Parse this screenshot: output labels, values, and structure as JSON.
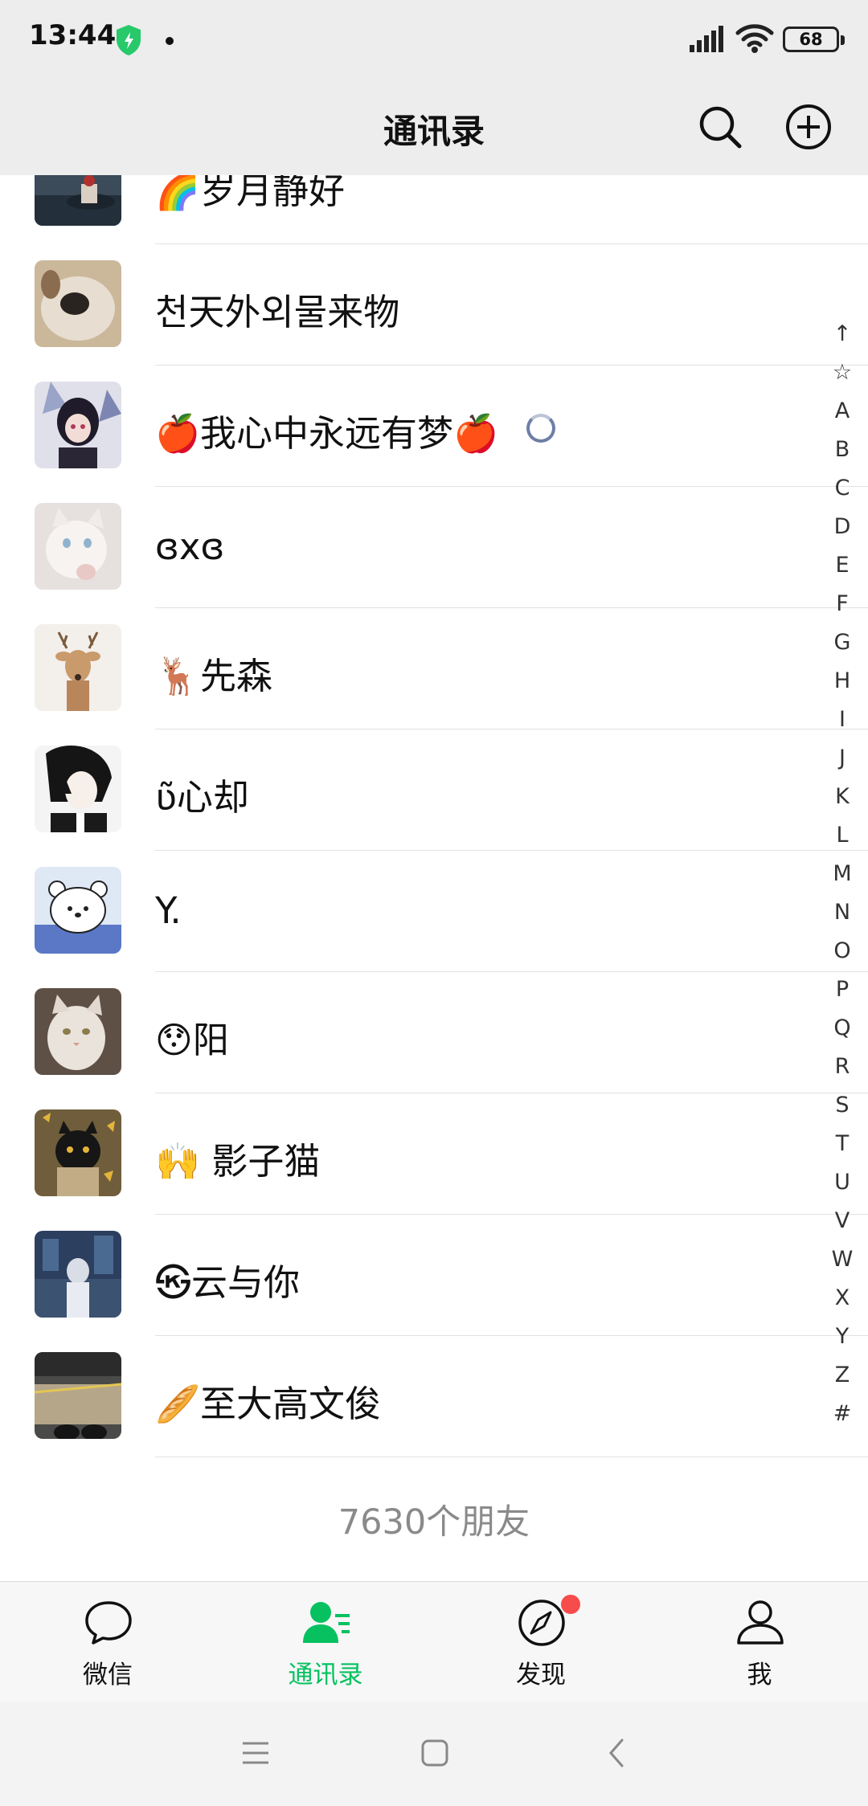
{
  "status_bar": {
    "time": "13:44",
    "battery": "68"
  },
  "header": {
    "title": "通讯录"
  },
  "contacts": [
    {
      "name": "🌈岁月静好",
      "avatar": "avatar-figure-on-rocks"
    },
    {
      "name": "천天外외물来物",
      "avatar": "avatar-dog-closeup"
    },
    {
      "name": "🍎我心中永远有梦🍎",
      "avatar": "avatar-anime-boy",
      "has_status": true
    },
    {
      "name": "ɞxɞ",
      "avatar": "avatar-white-kitten"
    },
    {
      "name": "🦌先森",
      "avatar": "avatar-deer-illustration"
    },
    {
      "name": "ʋ̃心却",
      "avatar": "avatar-anime-dark-hair"
    },
    {
      "name": "Y.",
      "avatar": "avatar-white-bear-cartoon"
    },
    {
      "name": "😯阳",
      "avatar": "avatar-white-cat"
    },
    {
      "name": "🙌 影子猫",
      "avatar": "avatar-black-cat-leaves"
    },
    {
      "name": "㉿云与你",
      "avatar": "avatar-dark-street-scene"
    },
    {
      "name": "🥖至大高文俊",
      "avatar": "avatar-road-photo"
    }
  ],
  "alphabet_index": [
    "↑",
    "☆",
    "A",
    "B",
    "C",
    "D",
    "E",
    "F",
    "G",
    "H",
    "I",
    "J",
    "K",
    "L",
    "M",
    "N",
    "O",
    "P",
    "Q",
    "R",
    "S",
    "T",
    "U",
    "V",
    "W",
    "X",
    "Y",
    "Z",
    "#"
  ],
  "footer": {
    "friend_count": "7630个朋友"
  },
  "bottom_nav": {
    "items": [
      {
        "label": "微信",
        "icon": "chat-bubble-icon",
        "active": false
      },
      {
        "label": "通讯录",
        "icon": "contacts-icon",
        "active": true
      },
      {
        "label": "发现",
        "icon": "compass-icon",
        "active": false,
        "badge": true
      },
      {
        "label": "我",
        "icon": "person-icon",
        "active": false
      }
    ]
  },
  "colors": {
    "accent": "#07c160",
    "header_bg": "#ededed",
    "badge": "#f74c4c"
  }
}
